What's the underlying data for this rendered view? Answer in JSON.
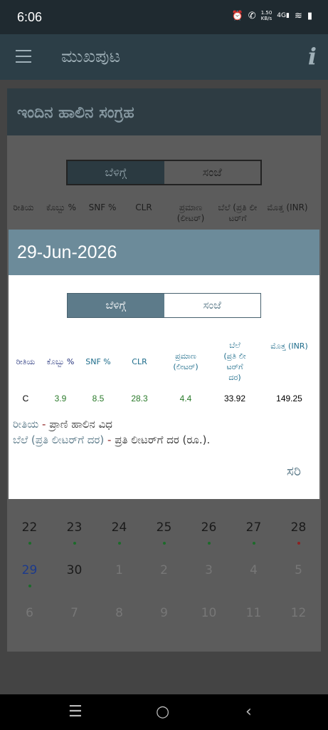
{
  "status": {
    "time": "6:06",
    "speed_value": "1.50",
    "speed_unit": "KB/s",
    "network": "4G"
  },
  "appbar": {
    "title": "ಮುಖಪುಟ",
    "info": "i"
  },
  "background": {
    "card_title": "ಇಂದಿನ ಹಾಲಿನ ಸಂಗ್ರಹ",
    "toggle": [
      "ಬೆಳಿಗ್ಗೆ",
      "ಸಂಜೆ"
    ],
    "headers": [
      "ರೀತಿಯ",
      "ಕೊಬ್ಬು %",
      "SNF %",
      "CLR",
      "ಪ್ರಮಾಣ (ಲೀಟರ್)",
      "ಬೆಲೆ (ಪ್ರತಿ ಲೀ ಟರ್‌ಗೆ",
      "ಮೊತ್ತ (INR)"
    ],
    "calendar": [
      [
        {
          "d": "22",
          "dot": "green"
        },
        {
          "d": "23",
          "dot": "green"
        },
        {
          "d": "24",
          "dot": "green"
        },
        {
          "d": "25",
          "dot": "green"
        },
        {
          "d": "26",
          "dot": "green"
        },
        {
          "d": "27",
          "dot": "green"
        },
        {
          "d": "28",
          "dot": "red"
        }
      ],
      [
        {
          "d": "29",
          "dot": "green",
          "today": true
        },
        {
          "d": "30"
        },
        {
          "d": "1",
          "faded": true
        },
        {
          "d": "2",
          "faded": true
        },
        {
          "d": "3",
          "faded": true
        },
        {
          "d": "4",
          "faded": true
        },
        {
          "d": "5",
          "faded": true
        }
      ],
      [
        {
          "d": "6",
          "faded": true
        },
        {
          "d": "7",
          "faded": true
        },
        {
          "d": "8",
          "faded": true
        },
        {
          "d": "9",
          "faded": true
        },
        {
          "d": "10",
          "faded": true
        },
        {
          "d": "11",
          "faded": true
        },
        {
          "d": "12",
          "faded": true
        }
      ]
    ]
  },
  "dialog": {
    "date": "29-Jun-2026",
    "toggle": {
      "morning": "ಬೆಳಿಗ್ಗೆ",
      "evening": "ಸಂಜೆ"
    },
    "headers": {
      "type": "ರೀತಿಯ",
      "fat": "ಕೊಬ್ಬು %",
      "snf": "SNF %",
      "clr": "CLR",
      "qty_1": "ಪ್ರಮಾಣ",
      "qty_2": "(ಲೀಟರ್)",
      "rate_1": "ಬೆಲೆ",
      "rate_2": "(ಪ್ರತಿ ಲೀ",
      "rate_3": "ಟರ್‌ಗೆ",
      "rate_4": "ದರ)",
      "total": "ಮೊತ್ತ (INR)"
    },
    "row": {
      "type": "C",
      "fat": "3.9",
      "snf": "8.5",
      "clr": "28.3",
      "qty": "4.4",
      "rate": "33.92",
      "total": "149.25"
    },
    "legend": [
      {
        "key": "ರೀತಿಯ",
        "value": "ಪ್ರಾಣಿ ಹಾಲಿನ ವಿಧ"
      },
      {
        "key": "ಬೆಲೆ (ಪ್ರತಿ ಲೀಟರ್‌ಗೆ ದರ)",
        "value": "ಪ್ರತಿ ಲೀಟರ್‌ಗೆ ದರ (ರೂ.)."
      }
    ],
    "ok": "ಸರಿ"
  },
  "colors": {
    "primary": "#6c8b9a",
    "appbar": "#2c3e47",
    "green_value": "#2a7a2a",
    "dash_red": "#8e2222"
  }
}
